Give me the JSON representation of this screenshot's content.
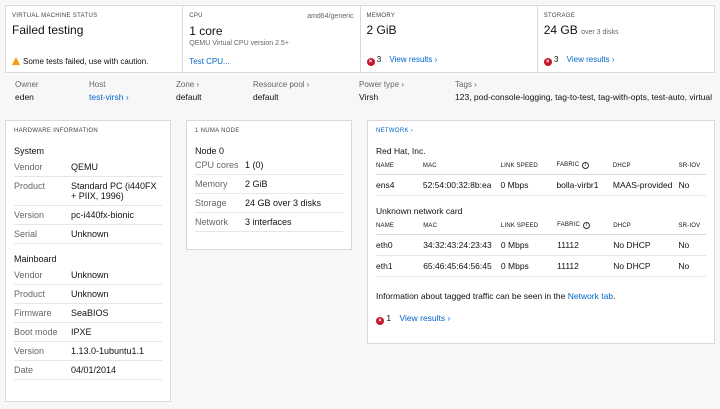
{
  "summary": {
    "status": {
      "title": "Virtual machine status",
      "value": "Failed testing",
      "warning": "Some tests failed, use with caution."
    },
    "cpu": {
      "title": "CPU",
      "arch": "amd64/generic",
      "value": "1 core",
      "sub": "QEMU Virtual CPU version 2.5+",
      "link": "Test CPU..."
    },
    "memory": {
      "title": "Memory",
      "value": "2 GiB",
      "fail_count": "3",
      "link": "View results ›"
    },
    "storage": {
      "title": "Storage",
      "value": "24 GB",
      "value_small": "over 3 disks",
      "fail_count": "3",
      "link": "View results ›"
    }
  },
  "owner_row": {
    "owner_label": "Owner",
    "owner": "eden",
    "host_label": "Host",
    "host": "test-virsh ›",
    "zone_label": "Zone ›",
    "zone": "default",
    "pool_label": "Resource pool ›",
    "pool": "default",
    "power_label": "Power type ›",
    "power": "Virsh",
    "tags_label": "Tags ›",
    "tags": "123, pod-console-logging, tag-to-test, tag-with-opts, test-auto, virtual"
  },
  "hardware": {
    "title": "Hardware information",
    "system_title": "System",
    "system": [
      {
        "k": "Vendor",
        "v": "QEMU"
      },
      {
        "k": "Product",
        "v": "Standard PC (i440FX + PIIX, 1996)"
      },
      {
        "k": "Version",
        "v": "pc-i440fx-bionic"
      },
      {
        "k": "Serial",
        "v": "Unknown"
      }
    ],
    "mainboard_title": "Mainboard",
    "mainboard": [
      {
        "k": "Vendor",
        "v": "Unknown"
      },
      {
        "k": "Product",
        "v": "Unknown"
      },
      {
        "k": "Firmware",
        "v": "SeaBIOS"
      },
      {
        "k": "Boot mode",
        "v": "IPXE"
      },
      {
        "k": "Version",
        "v": "1.13.0-1ubuntu1.1"
      },
      {
        "k": "Date",
        "v": "04/01/2014"
      }
    ]
  },
  "numa": {
    "title": "1 NUMA node",
    "node": "Node 0",
    "rows": [
      {
        "k": "CPU cores",
        "v": "1 (0)"
      },
      {
        "k": "Memory",
        "v": "2 GiB"
      },
      {
        "k": "Storage",
        "v": "24 GB over 3 disks"
      },
      {
        "k": "Network",
        "v": "3 interfaces"
      }
    ]
  },
  "network": {
    "title": "Network ›",
    "columns": [
      "Name",
      "MAC",
      "Link speed",
      "Fabric",
      "DHCP",
      "SR-IOV"
    ],
    "groups": [
      {
        "vendor": "Red Hat, Inc.",
        "rows": [
          [
            "ens4",
            "52:54:00:32:8b:ea",
            "0 Mbps",
            "bolla-virbr1",
            "MAAS-provided",
            "No"
          ]
        ]
      },
      {
        "vendor": "Unknown network card",
        "rows": [
          [
            "eth0",
            "34:32:43:24:23:43",
            "0 Mbps",
            "11112",
            "No DHCP",
            "No"
          ],
          [
            "eth1",
            "65:46:45:64:56:45",
            "0 Mbps",
            "11112",
            "No DHCP",
            "No"
          ]
        ]
      }
    ],
    "info_text": "Information about tagged traffic can be seen in the",
    "info_link": "Network tab",
    "info_end": ".",
    "fail_count": "1",
    "results_link": "View results ›"
  }
}
